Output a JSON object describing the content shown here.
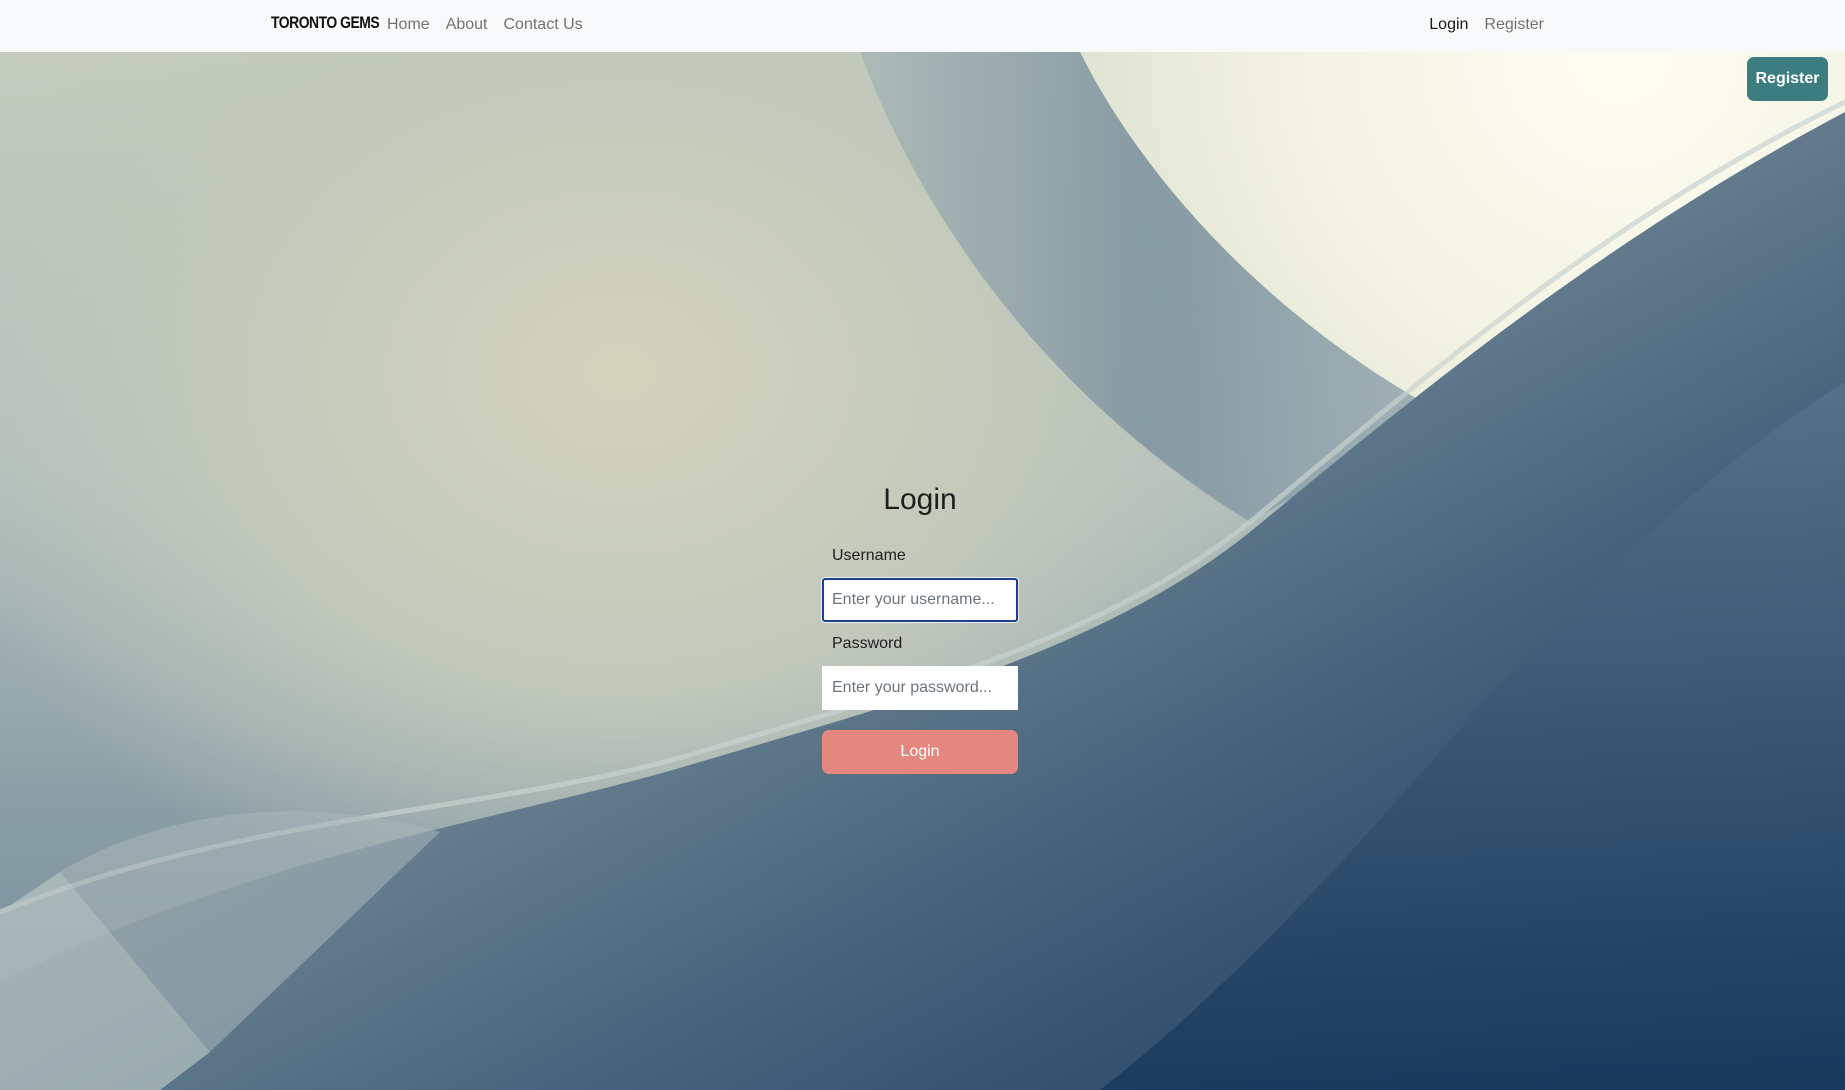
{
  "navbar": {
    "brand": "TORONTO GEMS",
    "links_left": [
      {
        "label": "Home"
      },
      {
        "label": "About"
      },
      {
        "label": "Contact Us"
      }
    ],
    "links_right": [
      {
        "label": "Login",
        "active": true
      },
      {
        "label": "Register",
        "active": false
      }
    ]
  },
  "floating_button": {
    "label": "Register",
    "color": "#3c7e80"
  },
  "login_form": {
    "title": "Login",
    "username_label": "Username",
    "username_placeholder": "Enter your username...",
    "password_label": "Password",
    "password_placeholder": "Enter your password...",
    "submit_label": "Login",
    "submit_color": "#e4877f"
  }
}
